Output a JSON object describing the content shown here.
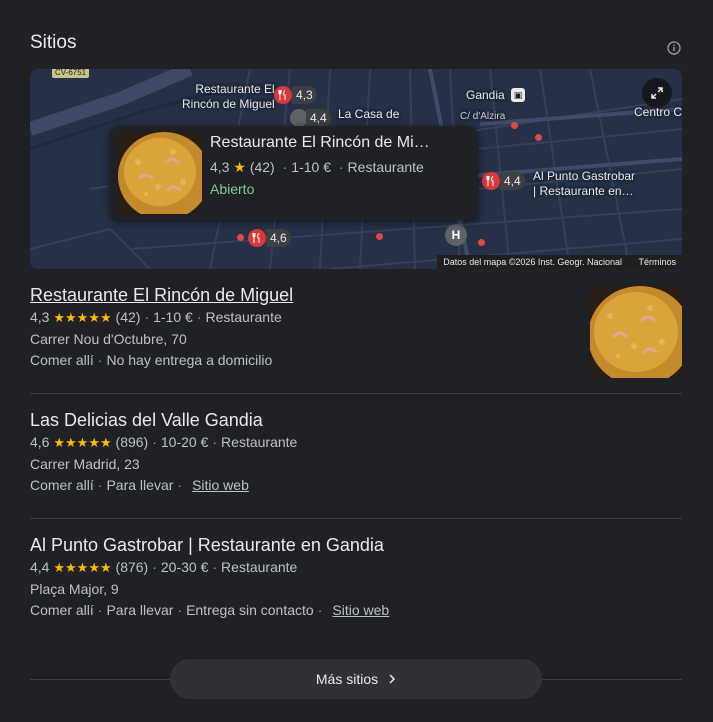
{
  "section": {
    "title": "Sitios"
  },
  "map": {
    "road_badge": "CV-6751",
    "labels": {
      "restaurant1_line1": "Restaurante El",
      "restaurant1_line2": "Rincón de Miguel",
      "casa_de": "La Casa de",
      "gandia": "Gandia",
      "alzira": "C/ d'Alzira",
      "centro": "Centro C",
      "alpunto_line1": "Al Punto Gastrobar",
      "alpunto_line2": "| Restaurante en…"
    },
    "pins": {
      "pin1_rating": "4,3",
      "pin2_rating": "4,4",
      "pin3_rating": "4,4",
      "pin4_rating": "4,6"
    },
    "hospital_label": "H",
    "footer": {
      "data": "Datos del mapa ©2026 Inst. Geogr. Nacional",
      "terms": "Términos"
    },
    "popup": {
      "name": "Restaurante El Rincón de Mi…",
      "rating": "4,3",
      "reviews": "(42)",
      "price": "1-10 €",
      "category": "Restaurante",
      "status": "Abierto"
    }
  },
  "places": [
    {
      "name": "Restaurante El Rincón de Miguel",
      "rating": "4,3",
      "stars": "★★★★★",
      "reviews": "(42)",
      "price": "1-10 €",
      "category": "Restaurante",
      "address": "Carrer Nou d'Octubre, 70",
      "services": [
        "Comer allí",
        "No hay entrega a domicilio"
      ]
    },
    {
      "name": "Las Delicias del Valle Gandia",
      "rating": "4,6",
      "stars": "★★★★★",
      "reviews": "(896)",
      "price": "10-20 €",
      "category": "Restaurante",
      "address": "Carrer Madrid, 23",
      "services": [
        "Comer allí",
        "Para llevar"
      ],
      "website": "Sitio web"
    },
    {
      "name": "Al Punto Gastrobar | Restaurante en Gandia",
      "rating": "4,4",
      "stars": "★★★★★",
      "reviews": "(876)",
      "price": "20-30 €",
      "category": "Restaurante",
      "address": "Plaça Major, 9",
      "services": [
        "Comer allí",
        "Para llevar",
        "Entrega sin contacto"
      ],
      "website": "Sitio web"
    }
  ],
  "more_button": {
    "label": "Más sitios"
  },
  "colors": {
    "background": "#202124",
    "pin": "#d93838",
    "open": "#81c995",
    "star": "#fbbc04"
  }
}
